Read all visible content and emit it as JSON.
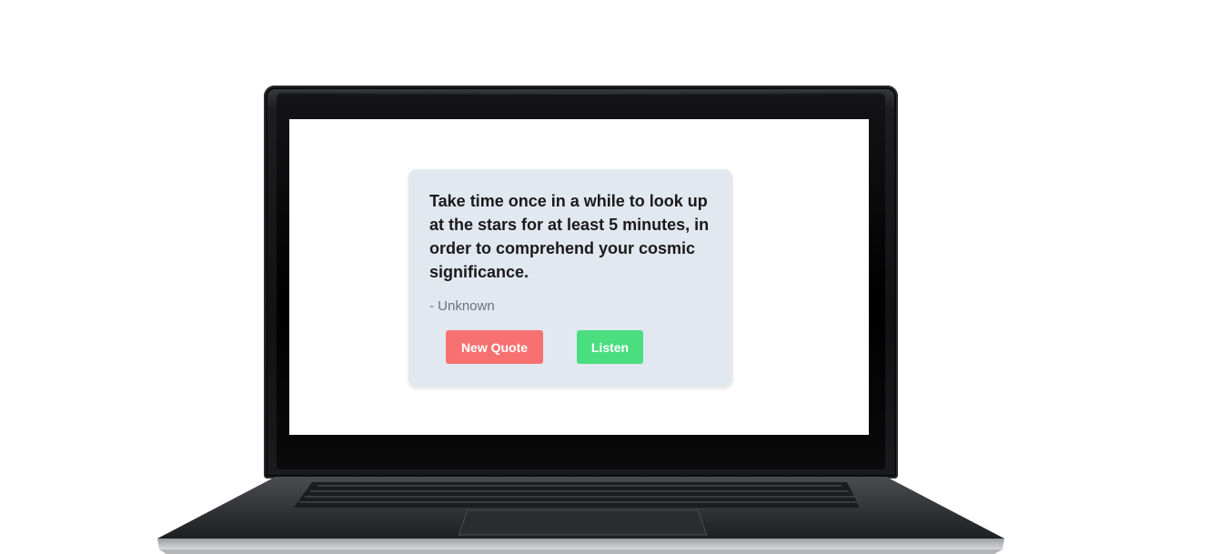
{
  "quote": {
    "text": "Take time once in a while to look up at the stars for at least 5 minutes, in order to comprehend your cosmic significance.",
    "author": "- Unknown"
  },
  "buttons": {
    "new_quote_label": "New Quote",
    "listen_label": "Listen"
  },
  "colors": {
    "card_background": "#e2e8f0",
    "new_quote_button": "#f87171",
    "listen_button": "#4ade80",
    "author_text": "#6b7280"
  }
}
